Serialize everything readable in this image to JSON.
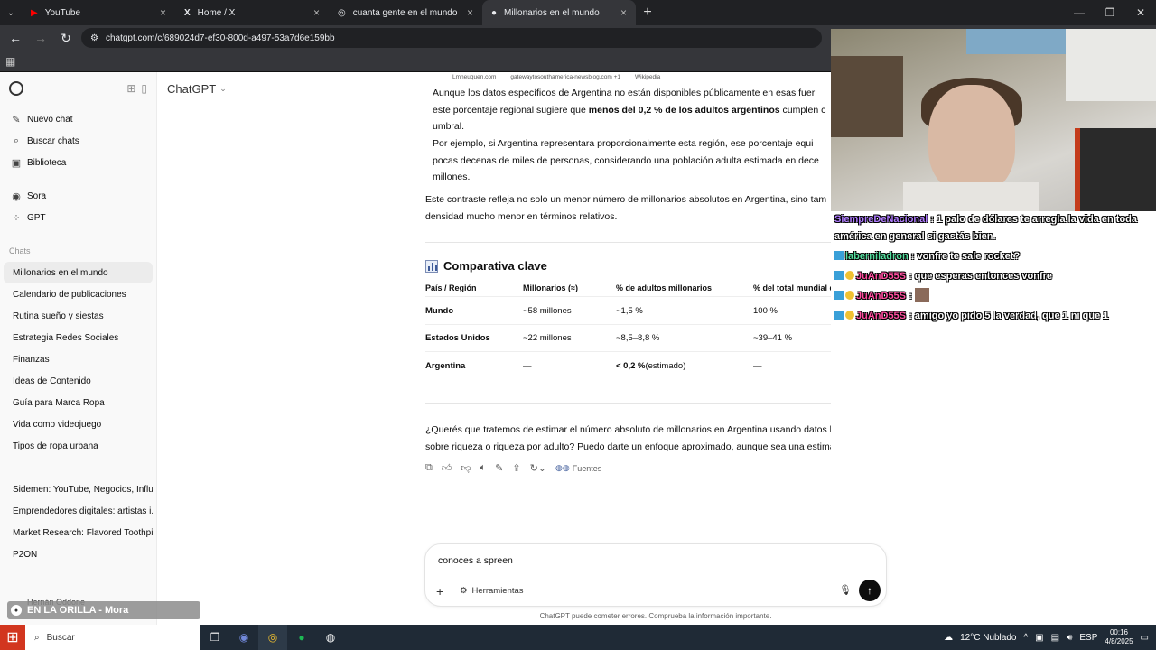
{
  "browser": {
    "tabs": [
      {
        "label": "YouTube",
        "icon": "youtube-icon"
      },
      {
        "label": "Home / X",
        "icon": "x-icon"
      },
      {
        "label": "cuanta gente en el mundo es m",
        "icon": "chatgpt-icon"
      },
      {
        "label": "Millonarios en el mundo",
        "icon": "chatgpt-icon",
        "active": true
      }
    ],
    "url": "chatgpt.com/c/689024d7-ef30-800d-a497-53a7d6e159bb"
  },
  "sidebar": {
    "primary": [
      {
        "label": "Nuevo chat",
        "icon": "compose-icon"
      },
      {
        "label": "Buscar chats",
        "icon": "search-icon"
      },
      {
        "label": "Biblioteca",
        "icon": "library-icon"
      }
    ],
    "secondary": [
      {
        "label": "Sora",
        "icon": "sora-icon"
      },
      {
        "label": "GPT",
        "icon": "gpt-grid-icon"
      }
    ],
    "section_label": "Chats",
    "chats": [
      "Millonarios en el mundo",
      "Calendario de publicaciones",
      "Rutina sueño y siestas",
      "Estrategia Redes Sociales",
      "Finanzas",
      "Ideas de Contenido",
      "Guía para Marca Ropa",
      "Vida como videojuego",
      "Tipos de ropa urbana"
    ],
    "chats2": [
      "Sidemen: YouTube, Negocios, Influ...",
      "Emprendedores digitales: artistas i...",
      "Market Research: Flavored Toothpi...",
      "P2ON"
    ],
    "user_name": "Hernán Oddone"
  },
  "header": {
    "model": "ChatGPT"
  },
  "message": {
    "sources": [
      "Lmneuquen.com",
      "gatewaytosouthamerica-newsblog.com +1",
      "Wikipedia"
    ],
    "bullet1_line1": "Aunque los datos específicos de Argentina no están disponibles públicamente en esas fuer",
    "bullet1_line2_a": "este porcentaje regional sugiere que ",
    "bullet1_line2_b": "menos del 0,2 % de los adultos argentinos",
    "bullet1_line2_c": " cumplen c",
    "bullet1_line3": "umbral.",
    "bullet2_line1": "Por ejemplo, si Argentina representara proporcionalmente esta región, ese porcentaje equi",
    "bullet2_line2": "pocas decenas de miles de personas, considerando una población adulta estimada en dece",
    "bullet2_line3": "millones.",
    "para_line1": "Este contraste refleja no solo un menor número de millonarios absolutos en Argentina, sino tam",
    "para_line2": "densidad mucho menor en términos relativos.",
    "heading": "Comparativa clave",
    "table": {
      "headers": [
        "País / Región",
        "Millonarios (≈)",
        "% de adultos millonarios",
        "% del total mundial de millonarios"
      ],
      "rows": [
        [
          "Mundo",
          "~58 millones",
          "~1,5 %",
          "100 %"
        ],
        [
          "Estados Unidos",
          "~22 millones",
          "~8,5–8,8 %",
          "~39–41 %"
        ],
        [
          "Argentina",
          "—",
          "< 0,2 %",
          "—"
        ]
      ],
      "ar_estimate_suffix": " (estimado)"
    },
    "question_line1": "¿Querés que tratemos de estimar el número absoluto de millonarios en Argentina usando datos locales",
    "question_line2": "sobre riqueza o riqueza por adulto? Puedo darte un enfoque aproximado, aunque sea una estimación.",
    "sources_button": "Fuentes"
  },
  "composer": {
    "value": "conoces a spreen",
    "tools_label": "Herramientas",
    "disclaimer": "ChatGPT puede cometer errores. Comprueba la información importante."
  },
  "stream_chat": [
    {
      "user": "SiempreDeNacional",
      "text": ": 1 palo de dólares te arregla la vida en toda américa en general si gastás bien."
    },
    {
      "user": "laberniladron",
      "text": ": vonfre te sale rocket?"
    },
    {
      "user": "JuAnD55S",
      "text": ": que esperas entonces vonfre"
    },
    {
      "user": "JuAnD55S",
      "text": ":"
    },
    {
      "user": "JuAnD55S",
      "text": ": amigo yo pido 5 la verdad, que 1 ni que 1"
    }
  ],
  "spotify": {
    "track": "EN LA ORILLA - Mora"
  },
  "taskbar": {
    "search_placeholder": "Buscar",
    "weather": "12°C  Nublado",
    "lang": "ESP",
    "time": "00:16",
    "date": "4/8/2025"
  }
}
